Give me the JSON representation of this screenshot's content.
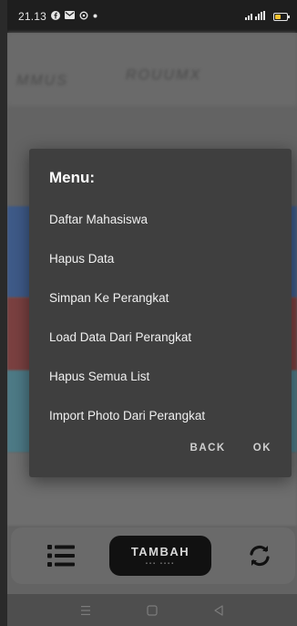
{
  "status_bar": {
    "time": "21.13",
    "icons": [
      "facebook-icon",
      "mail-icon",
      "sync-icon",
      "dot-icon"
    ],
    "network": "signal-icon",
    "battery_color": "#f2c230"
  },
  "dialog": {
    "title": "Menu:",
    "items": [
      "Daftar Mahasiswa",
      "Hapus Data",
      "Simpan Ke Perangkat",
      "Load Data Dari Perangkat",
      "Hapus Semua List",
      "Import Photo Dari Perangkat"
    ],
    "back_label": "BACK",
    "ok_label": "OK"
  },
  "toolbar": {
    "add_label": "TAMBAH"
  }
}
